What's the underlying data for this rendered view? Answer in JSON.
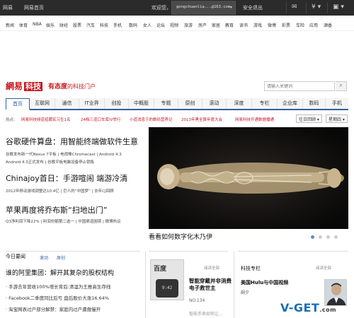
{
  "topbar": {
    "links": [
      "网易",
      "网易首页"
    ],
    "welcome": "欢迎您，",
    "email": "gongchuanlia...@163.com",
    "logout": "安全退出",
    "icons": [
      "mail-icon",
      "coin-icon",
      "app-icon"
    ]
  },
  "channels": [
    "新闻",
    "体育",
    "NBA",
    "娱乐",
    "财经",
    "股票",
    "汽车",
    "科技",
    "手机",
    "数码",
    "女人",
    "论坛",
    "视频",
    "旅游",
    "房产",
    "家居",
    "教育",
    "读书",
    "游戏",
    "微博",
    "彩票",
    "车险",
    "应用",
    "酒香"
  ],
  "logo": {
    "brand": "網易",
    "section": "科技",
    "slogan_bold": "有态度",
    "slogan_rest": "的科技门户"
  },
  "search": {
    "placeholder": "请输入关键词"
  },
  "mainnav": [
    "首页",
    "互联网",
    "通信",
    "IT业界",
    "创投",
    "中概股",
    "专题",
    "原创",
    "滚动",
    "深度",
    "专栏",
    "企业库",
    "数码",
    "手机"
  ],
  "hot": {
    "label": "热点：",
    "items": [
      "网易科技频道招聘实习生1名",
      "24档三道口车库IV举行",
      "小道消息下的数码营养记",
      "2013年黑全算年度大会",
      "网易科技开通数据播通"
    ]
  },
  "selects": {
    "first": "往日回顾 ▾",
    "second": "星期四 ▾"
  },
  "headline1": {
    "title": "谷歌硬件算盘：用智能终端做软件生意",
    "sub1": "谷歌发布新一代Nexus 7平板 | 电视棒Chromecast | Android 4.3",
    "sub2": "Android 4.3正式发布 | 谷歌平板电脑设备停止销售"
  },
  "headline2": {
    "title": "Chinajoy首日：手游喧闹 端游冷清",
    "sub": "2012年移动游戏调整达10.4亿 | 巨人的“中国梦” | 去年CJ回顾"
  },
  "headline3": {
    "title": "苹果再度将乔布斯“扫地出门”",
    "sub": "Q3净利润下降22% | 利润份额第二选一 | 中国渠道困境 | 微博热议"
  },
  "photo": {
    "caption": "看看如何数字化木乃伊"
  },
  "today": {
    "title": "今日要闻",
    "tabs": [
      "滚动",
      "原创"
    ],
    "headline": "谁的阿里集团：解开其复杂的股权结构",
    "bullets": [
      "· 手游去年营收100%增长背后:清湿为王推高生存线",
      "· Facebook二季度同比后亏 盘后股价大涨16.64%",
      "· 淘宝网表过户部分解禁：家庭内过户遭傲慢开"
    ]
  },
  "card": {
    "thumb_title": "百度",
    "watch_time": "9:42",
    "read_tag": "阅读全部",
    "title": "智能穿戴并非消费电子救世主",
    "num": "NO.134",
    "more": "智能手表如何让..."
  },
  "right": {
    "head": "科技专栏",
    "tag": "阅读全部",
    "title": "美国Hulu与中国视频",
    "author": "阚夕"
  },
  "watermark": {
    "main": "V-GET",
    "suffix": ".com"
  }
}
